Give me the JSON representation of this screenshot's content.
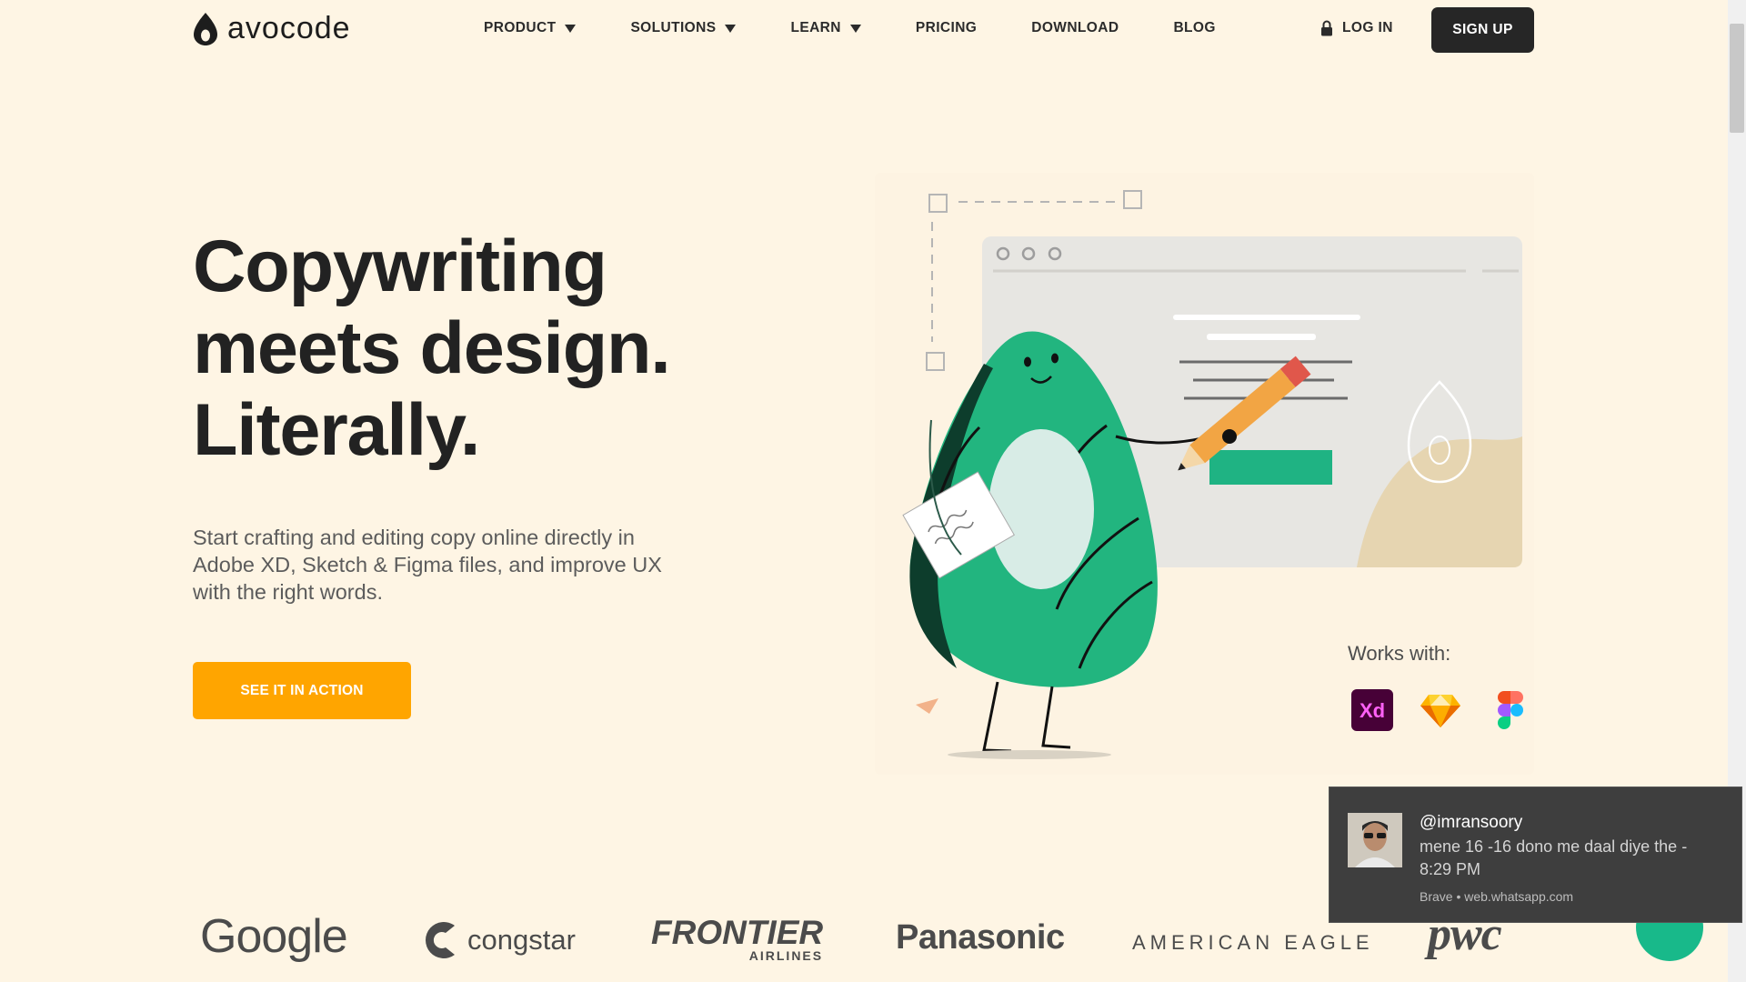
{
  "header": {
    "logo_text": "avocode",
    "nav": [
      {
        "label": "PRODUCT",
        "has_dropdown": true
      },
      {
        "label": "SOLUTIONS",
        "has_dropdown": true
      },
      {
        "label": "LEARN",
        "has_dropdown": true
      },
      {
        "label": "PRICING",
        "has_dropdown": false
      },
      {
        "label": "DOWNLOAD",
        "has_dropdown": false
      },
      {
        "label": "BLOG",
        "has_dropdown": false
      }
    ],
    "login_label": "LOG IN",
    "signup_label": "SIGN UP"
  },
  "hero": {
    "headline_lines": [
      "Copywriting",
      "meets design.",
      "Literally."
    ],
    "subtext": "Start crafting and editing copy online directly in Adobe XD, Sketch & Figma files, and improve UX with the right words.",
    "cta_label": "SEE IT IN ACTION"
  },
  "illustration": {
    "works_with_label": "Works with:",
    "tools": [
      {
        "name": "Adobe XD",
        "icon": "adobe-xd-icon",
        "icon_text": "Xd"
      },
      {
        "name": "Sketch",
        "icon": "sketch-icon"
      },
      {
        "name": "Figma",
        "icon": "figma-icon"
      }
    ]
  },
  "clients": {
    "google": "Google",
    "congstar": "congstar",
    "frontier": "FRONTIER",
    "frontier_sub": "AIRLINES",
    "panasonic": "Panasonic",
    "american_eagle": "AMERICAN EAGLE",
    "pwc": "pwc"
  },
  "notification": {
    "sender": "@imransoory",
    "message": "mene 16 -16 dono me daal diye the - 8:29 PM",
    "source": "Brave • web.whatsapp.com"
  },
  "colors": {
    "background": "#fef5e4",
    "cta": "#ffa500",
    "signup_bg": "#262626",
    "avocado_green": "#22b57f",
    "chat_fab": "#18b98a"
  }
}
